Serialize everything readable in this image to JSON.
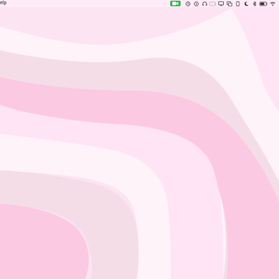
{
  "menubar": {
    "left_items": [
      {
        "label": "elp"
      }
    ],
    "status_icons": [
      "facetime-video-icon",
      "screen-time-icon",
      "time-machine-icon",
      "headphones-icon",
      "battery-case-icon",
      "display-icon",
      "screen-mirror-icon",
      "mobile-device-icon",
      "night-moon-icon",
      "bluetooth-icon",
      "battery-icon",
      "wifi-icon"
    ]
  },
  "colors": {
    "facetime_green": "#2fb84a",
    "wallpaper_band_1": "#fde4f3",
    "wallpaper_band_2": "#fff3fa",
    "wallpaper_band_3": "#f5dde8",
    "wallpaper_band_4": "#fcc9e3",
    "wallpaper_band_5": "#ffe4f5"
  }
}
